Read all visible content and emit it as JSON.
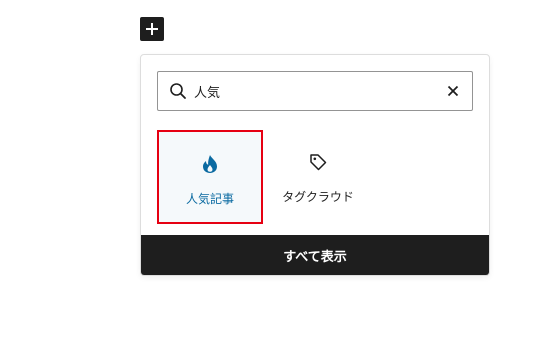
{
  "inserter_toggle": {
    "icon": "plus-icon"
  },
  "search": {
    "value": "人気",
    "icon": "search-icon",
    "clear_icon": "close-icon"
  },
  "results": [
    {
      "label": "人気記事",
      "icon": "flame-icon",
      "selected": true,
      "color": "#0a6aa1"
    },
    {
      "label": "タグクラウド",
      "icon": "tag-icon",
      "selected": false
    }
  ],
  "browse_all": {
    "label": "すべて表示"
  },
  "colors": {
    "highlight_border": "#e60012",
    "dark": "#1e1e1e",
    "accent": "#0a6aa1"
  }
}
